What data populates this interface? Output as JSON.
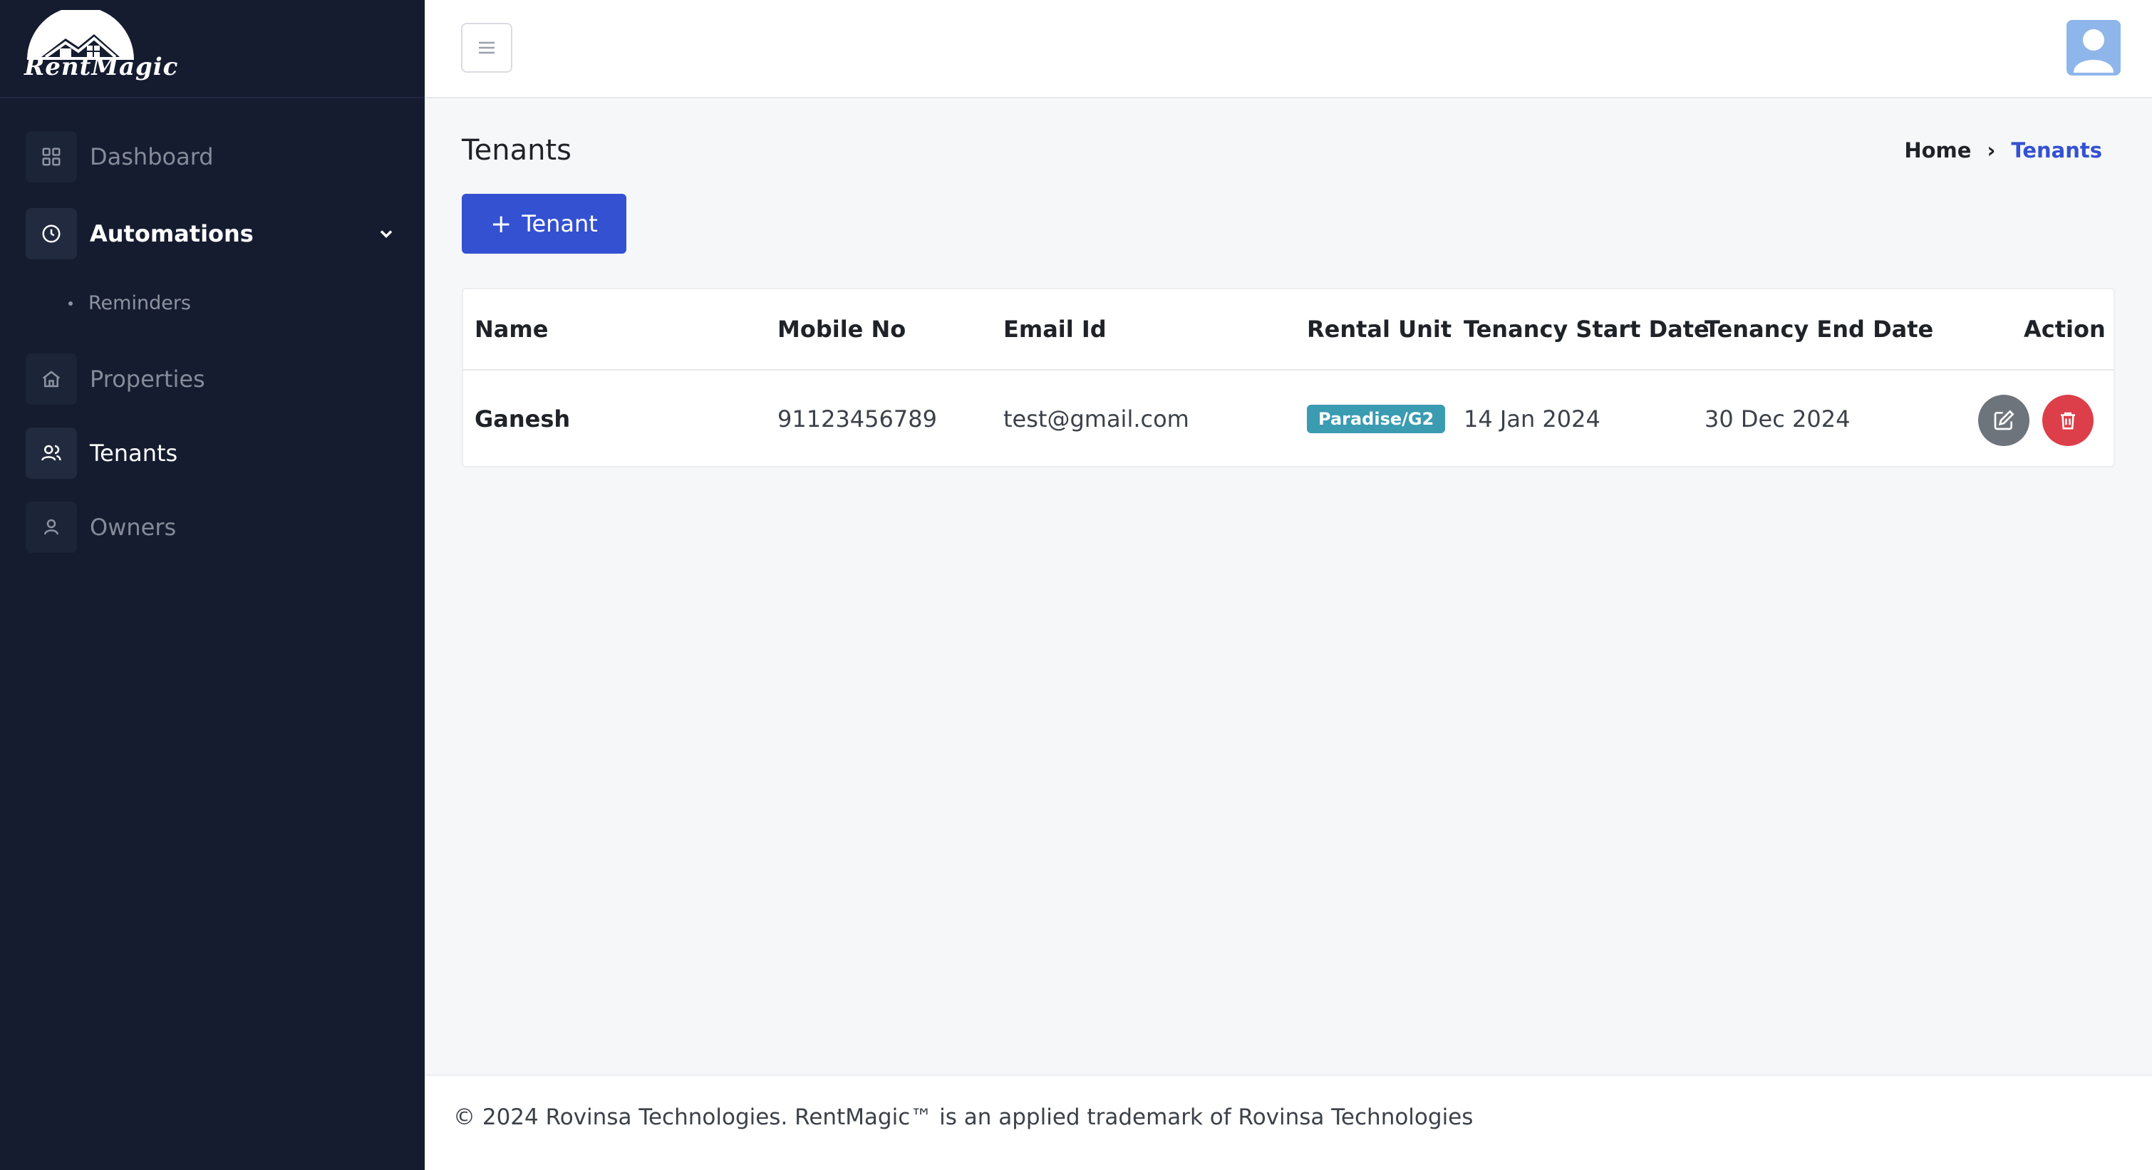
{
  "brand": {
    "name": "RentMagic"
  },
  "sidebar": {
    "items": [
      {
        "label": "Dashboard",
        "icon": "dashboard-icon"
      },
      {
        "label": "Automations",
        "icon": "clock-icon"
      },
      {
        "label": "Properties",
        "icon": "home-icon"
      },
      {
        "label": "Tenants",
        "icon": "users-icon"
      },
      {
        "label": "Owners",
        "icon": "user-icon"
      }
    ],
    "sub_items": [
      {
        "label": "Reminders"
      }
    ]
  },
  "header": {
    "menu_icon": "hamburger-icon",
    "avatar_icon": "avatar-icon"
  },
  "page": {
    "title": "Tenants",
    "add_button": {
      "icon": "+",
      "label": "Tenant"
    }
  },
  "breadcrumb": {
    "home": "Home",
    "separator": "›",
    "current": "Tenants"
  },
  "table": {
    "headers": [
      "Name",
      "Mobile No",
      "Email Id",
      "Rental Unit",
      "Tenancy Start Date",
      "Tenancy End Date",
      "Action"
    ],
    "rows": [
      {
        "name": "Ganesh",
        "mobile": "91123456789",
        "email": "test@gmail.com",
        "rental_unit": "Paradise/G2",
        "start_date": "14 Jan 2024",
        "end_date": "30 Dec 2024"
      }
    ]
  },
  "footer": {
    "text": "© 2024 Rovinsa Technologies. RentMagic™ is an applied trademark of Rovinsa Technologies"
  },
  "colors": {
    "sidebar_bg": "#151c30",
    "primary": "#3451d1",
    "badge": "#3a9bb1",
    "edit": "#6d747c",
    "delete": "#dc3f4a"
  }
}
